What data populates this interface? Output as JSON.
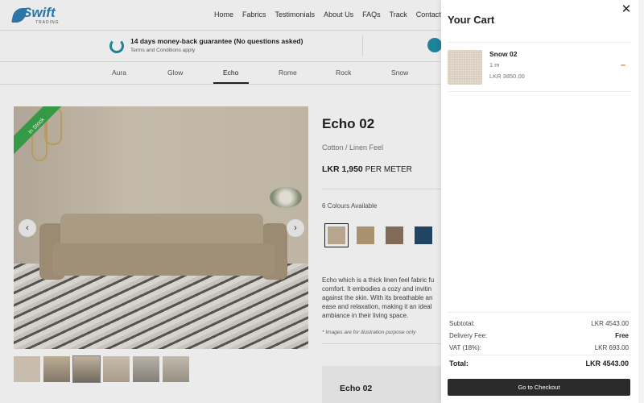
{
  "brand": {
    "name": "Swift",
    "tagline": "TRADING"
  },
  "nav": [
    "Home",
    "Fabrics",
    "Testimonials",
    "About Us",
    "FAQs",
    "Track",
    "Contact Us"
  ],
  "guarantee": {
    "title": "14 days money-back guarantee (No questions asked)",
    "subtitle": "Terms and Conditions apply"
  },
  "tabs": [
    "Aura",
    "Glow",
    "Echo",
    "Rome",
    "Rock",
    "Snow"
  ],
  "active_tab": "Echo",
  "hero": {
    "badge": "In Stock",
    "prev": "‹",
    "next": "›"
  },
  "product": {
    "title": "Echo 02",
    "subtitle": "Cotton / Linen Feel",
    "price": "LKR 1,950",
    "price_unit": "PER METER",
    "colours_label": "6 Colours Available",
    "description": [
      "Echo which is a thick linen feel fabric fu",
      "comfort. It embodies a cozy and invitin",
      "against the skin. With its breathable an",
      "ease and relaxation, making it an ideal",
      "ambiance in their living space."
    ],
    "note": "Images are for illustration purpose only",
    "box_title": "Echo 02",
    "swatch_colors": [
      "#c7b49a",
      "#b89d78",
      "#8c7560",
      "#244a6b"
    ]
  },
  "cart": {
    "title": "Your Cart",
    "close_icon": "✕",
    "items": [
      {
        "name": "Snow 02",
        "qty": "1 m",
        "price": "LKR 3850.00",
        "remove": "–"
      }
    ],
    "subtotal_label": "Subtotal:",
    "subtotal": "LKR 4543.00",
    "delivery_label": "Delivery Fee:",
    "delivery": "Free",
    "vat_label": "VAT (18%):",
    "vat": "LKR 693.00",
    "total_label": "Total:",
    "total": "LKR 4543.00",
    "checkout": "Go to Checkout"
  },
  "colors": {
    "accent": "#1f8fa6",
    "badge": "#3aa84d",
    "remove": "#e05a2b",
    "button": "#2b2b2b"
  }
}
